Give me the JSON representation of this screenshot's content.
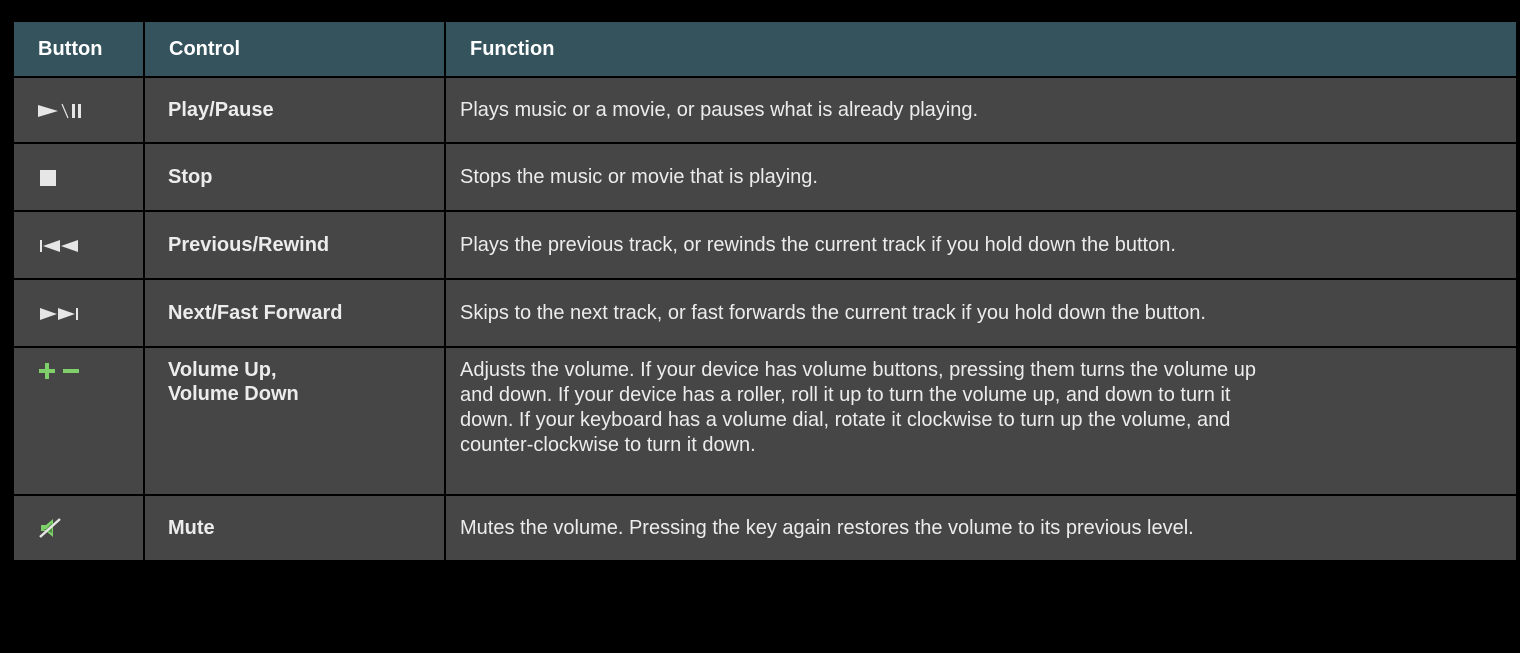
{
  "table": {
    "headers": {
      "button": "Button",
      "control": "Control",
      "function": "Function"
    },
    "rows": [
      {
        "icon": "play-pause-icon",
        "control": "Play/Pause",
        "function": "Plays music or a movie, or pauses what is already playing."
      },
      {
        "icon": "stop-icon",
        "control": "Stop",
        "function": "Stops the music or movie that is playing."
      },
      {
        "icon": "previous-rewind-icon",
        "control": "Previous/Rewind",
        "function": "Plays the previous track, or rewinds the current track if you hold down the button."
      },
      {
        "icon": "next-fast-forward-icon",
        "control": "Next/Fast Forward",
        "function": "Skips to the next track, or fast forwards the current track if you hold down the button."
      },
      {
        "icon": "volume-up-down-icon",
        "control": "Volume Up,\n Volume Down",
        "function": "Adjusts the volume. If your device has volume buttons, pressing them turns the volume up\n and down. If your device has a roller, roll it up to turn the volume up, and down to turn it\n down. If your keyboard has a volume dial, rotate it clockwise to turn up the volume, and\n counter-clockwise to turn it down."
      },
      {
        "icon": "mute-icon",
        "control": "Mute",
        "function": "Mutes the volume. Pressing the key again restores the volume to its previous level."
      }
    ]
  },
  "colors": {
    "header_bg": "#35535d",
    "row_bg": "#464646",
    "border": "#000000",
    "icon_light": "#e6e6e6",
    "icon_green": "#7fd06a"
  }
}
